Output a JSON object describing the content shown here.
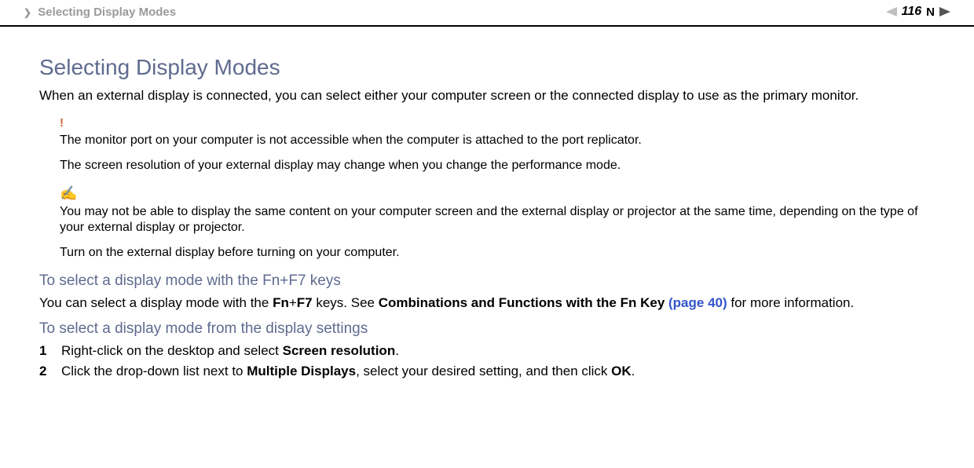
{
  "header": {
    "breadcrumb": "Selecting Display Modes",
    "page_number": "116",
    "n_label": "N"
  },
  "main": {
    "heading": "Selecting Display Modes",
    "intro": "When an external display is connected, you can select either your computer screen or the connected display to use as the primary monitor.",
    "warning_icon": "!",
    "warning_text_1": "The monitor port on your computer is not accessible when the computer is attached to the port replicator.",
    "warning_text_2": "The screen resolution of your external display may change when you change the performance mode.",
    "note_icon": "✍",
    "note_text_1": "You may not be able to display the same content on your computer screen and the external display or projector at the same time, depending on the type of your external display or projector.",
    "note_text_2": "Turn on the external display before turning on your computer.",
    "sub1_heading": "To select a display mode with the Fn+F7 keys",
    "sub1_pre": "You can select a display mode with the ",
    "sub1_fn": "Fn",
    "sub1_plus": "+",
    "sub1_f7": "F7",
    "sub1_mid": " keys. See ",
    "sub1_link_bold": "Combinations and Functions with the Fn Key ",
    "sub1_link": "(page 40)",
    "sub1_post": " for more information.",
    "sub2_heading": "To select a display mode from the display settings",
    "steps": {
      "s1_num": "1",
      "s1_pre": "Right-click on the desktop and select ",
      "s1_bold": "Screen resolution",
      "s1_post": ".",
      "s2_num": "2",
      "s2_pre": "Click the drop-down list next to ",
      "s2_bold1": "Multiple Displays",
      "s2_mid": ", select your desired setting, and then click ",
      "s2_bold2": "OK",
      "s2_post": "."
    }
  }
}
